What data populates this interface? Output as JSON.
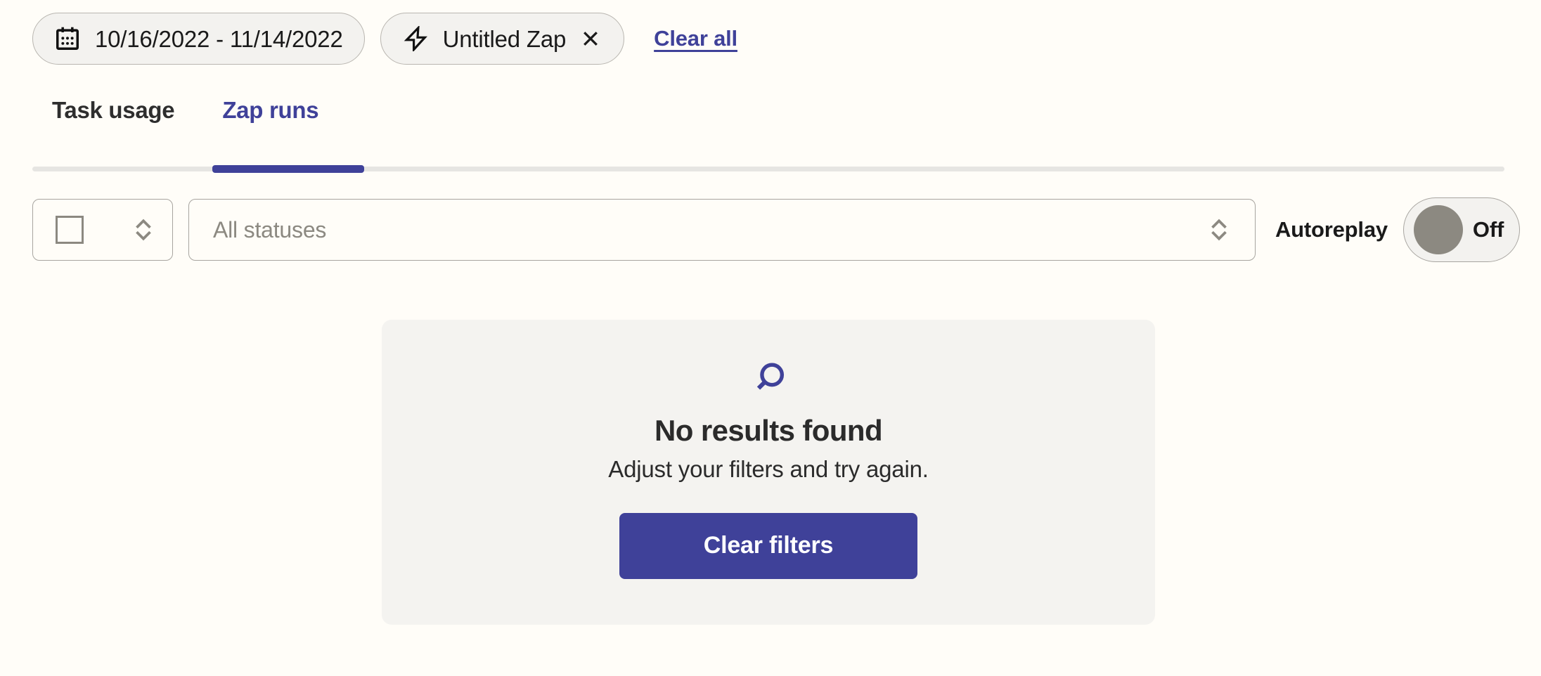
{
  "theme": {
    "page_bg": "#FFFDF8",
    "accent": "#3F4199",
    "panel_bg": "#F4F3F0",
    "chip_bg": "#F3F2EF",
    "muted_text": "#8C8981",
    "border": "#A8A5A0"
  },
  "filter_chips": {
    "date_chip": {
      "icon": "calendar-icon",
      "label": "10/16/2022 - 11/14/2022"
    },
    "zap_chip": {
      "icon": "lightning-bolt-icon",
      "label": "Untitled Zap",
      "close_icon": "close-icon"
    },
    "clear_all_label": "Clear all"
  },
  "tabs": [
    {
      "label": "Task usage",
      "active": false
    },
    {
      "label": "Zap runs",
      "active": true
    }
  ],
  "controls": {
    "checkbox_select": {
      "icon": "checkbox-icon",
      "chevron_icon": "chevron-up-down-icon"
    },
    "status_select": {
      "value": "All statuses",
      "placeholder": "All statuses",
      "chevron_icon": "chevron-up-down-icon"
    },
    "autoreplay": {
      "label": "Autoreplay",
      "state": "Off",
      "on": false
    }
  },
  "empty_state": {
    "icon": "search-icon",
    "title": "No results found",
    "subtitle": "Adjust your filters and try again.",
    "button_label": "Clear filters"
  }
}
